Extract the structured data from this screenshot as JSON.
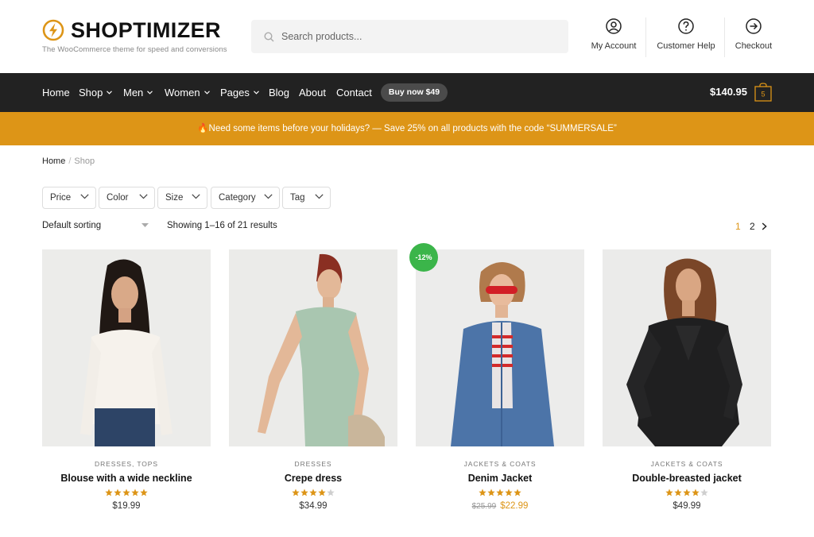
{
  "brand": {
    "name": "SHOPTIMIZER",
    "tagline": "The WooCommerce theme for speed and conversions",
    "accent": "#dd9517"
  },
  "search": {
    "placeholder": "Search products...",
    "icon": "search-icon"
  },
  "header_links": [
    {
      "label": "My Account",
      "icon": "user-circle-icon"
    },
    {
      "label": "Customer Help",
      "icon": "question-circle-icon"
    },
    {
      "label": "Checkout",
      "icon": "arrow-right-circle-icon"
    }
  ],
  "nav": {
    "items": [
      {
        "label": "Home",
        "dropdown": false
      },
      {
        "label": "Shop",
        "dropdown": true
      },
      {
        "label": "Men",
        "dropdown": true
      },
      {
        "label": "Women",
        "dropdown": true
      },
      {
        "label": "Pages",
        "dropdown": true
      },
      {
        "label": "Blog",
        "dropdown": false
      },
      {
        "label": "About",
        "dropdown": false
      },
      {
        "label": "Contact",
        "dropdown": false
      }
    ],
    "buy_button": "Buy now $49",
    "cart_total": "$140.95",
    "cart_count": "5"
  },
  "promo": {
    "text": "🔥Need some items before your holidays? — Save 25% on all products with the code “SUMMERSALE”"
  },
  "breadcrumb": {
    "home": "Home",
    "separator": "/",
    "current": "Shop"
  },
  "filters": [
    "Price",
    "Color",
    "Size",
    "Category",
    "Tag"
  ],
  "toolbar": {
    "sorting": "Default sorting",
    "results": "Showing 1–16 of 21 results",
    "pages": [
      "1",
      "2"
    ],
    "current_page": "1"
  },
  "products": [
    {
      "category": "DRESSES, TOPS",
      "name": "Blouse with a wide neckline",
      "rating": 5,
      "price": "$19.99",
      "old_price": "",
      "badge": ""
    },
    {
      "category": "DRESSES",
      "name": "Crepe dress",
      "rating": 4,
      "price": "$34.99",
      "old_price": "",
      "badge": ""
    },
    {
      "category": "JACKETS & COATS",
      "name": "Denim Jacket",
      "rating": 5,
      "price": "$22.99",
      "old_price": "$25.99",
      "badge": "-12%"
    },
    {
      "category": "JACKETS & COATS",
      "name": "Double-breasted jacket",
      "rating": 4,
      "price": "$49.99",
      "old_price": "",
      "badge": ""
    }
  ],
  "colors": {
    "star_on": "#dd9517",
    "star_off": "#cfcfcf",
    "badge": "#3bb54a",
    "navbar": "#222222"
  }
}
